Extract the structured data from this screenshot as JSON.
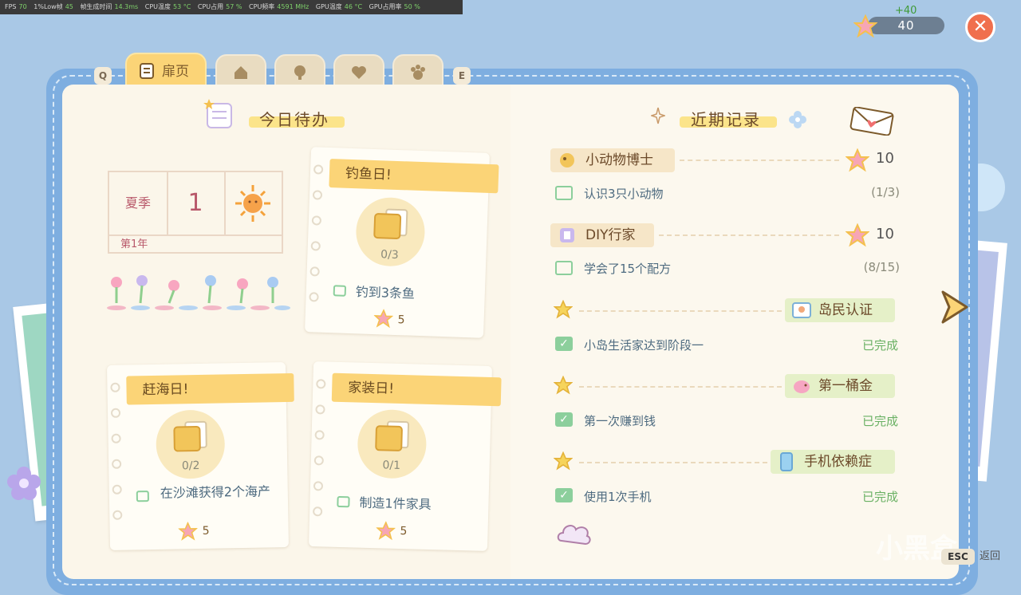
{
  "perf": {
    "fps_label": "FPS",
    "fps": "70",
    "low_label": "1%Low帧",
    "low": "45",
    "frametime_label": "帧生成时间",
    "frametime": "14.3ms",
    "cpu_temp_label": "CPU温度",
    "cpu_temp": "53 °C",
    "cpu_use_label": "CPU占用",
    "cpu_use": "57 %",
    "cpu_freq_label": "CPU频率",
    "cpu_freq": "4591 MHz",
    "gpu_temp_label": "GPU温度",
    "gpu_temp": "46 °C",
    "gpu_use_label": "GPU占用率",
    "gpu_use": "50 %"
  },
  "currency": {
    "gain": "+40",
    "value": "40",
    "color": "#6d7f92"
  },
  "tabs": {
    "prev_key": "Q",
    "next_key": "E",
    "active_label": "扉页",
    "icons": [
      "house-icon",
      "tree-icon",
      "heart-hands-icon",
      "paw-icon"
    ]
  },
  "left": {
    "heading": "今日待办",
    "calendar": {
      "season": "夏季",
      "day": "1",
      "year": "第1年",
      "weather_icon": "sun-icon"
    },
    "cards": [
      {
        "title": "钓鱼日!",
        "progress": "0/3",
        "task": "钓到3条鱼",
        "reward": "5",
        "done_fraction": 0
      },
      {
        "title": "赶海日!",
        "progress": "0/2",
        "task": "在沙滩获得2个海产",
        "reward": "5",
        "done_fraction": 0
      },
      {
        "title": "家装日!",
        "progress": "0/1",
        "task": "制造1件家具",
        "reward": "5",
        "done_fraction": 0
      }
    ]
  },
  "right": {
    "heading": "近期记录",
    "records": [
      {
        "title": "小动物博士",
        "reward": "10",
        "task": "认识3只小动物",
        "progress": "(1/3)"
      },
      {
        "title": "DIY行家",
        "reward": "10",
        "task": "学会了15个配方",
        "progress": "(8/15)"
      },
      {
        "badge": "岛民认证",
        "task": "小岛生活家达到阶段一",
        "status": "已完成"
      },
      {
        "badge": "第一桶金",
        "task": "第一次赚到钱",
        "status": "已完成"
      },
      {
        "badge": "手机依赖症",
        "task": "使用1次手机",
        "status": "已完成"
      }
    ]
  },
  "footer": {
    "esc_key": "ESC",
    "esc_label": "返回",
    "watermark": "小黑盒"
  },
  "colors": {
    "accent": "#fbd477",
    "close": "#f06f4d",
    "done": "#6ab164",
    "page": "#fbf6ea"
  }
}
